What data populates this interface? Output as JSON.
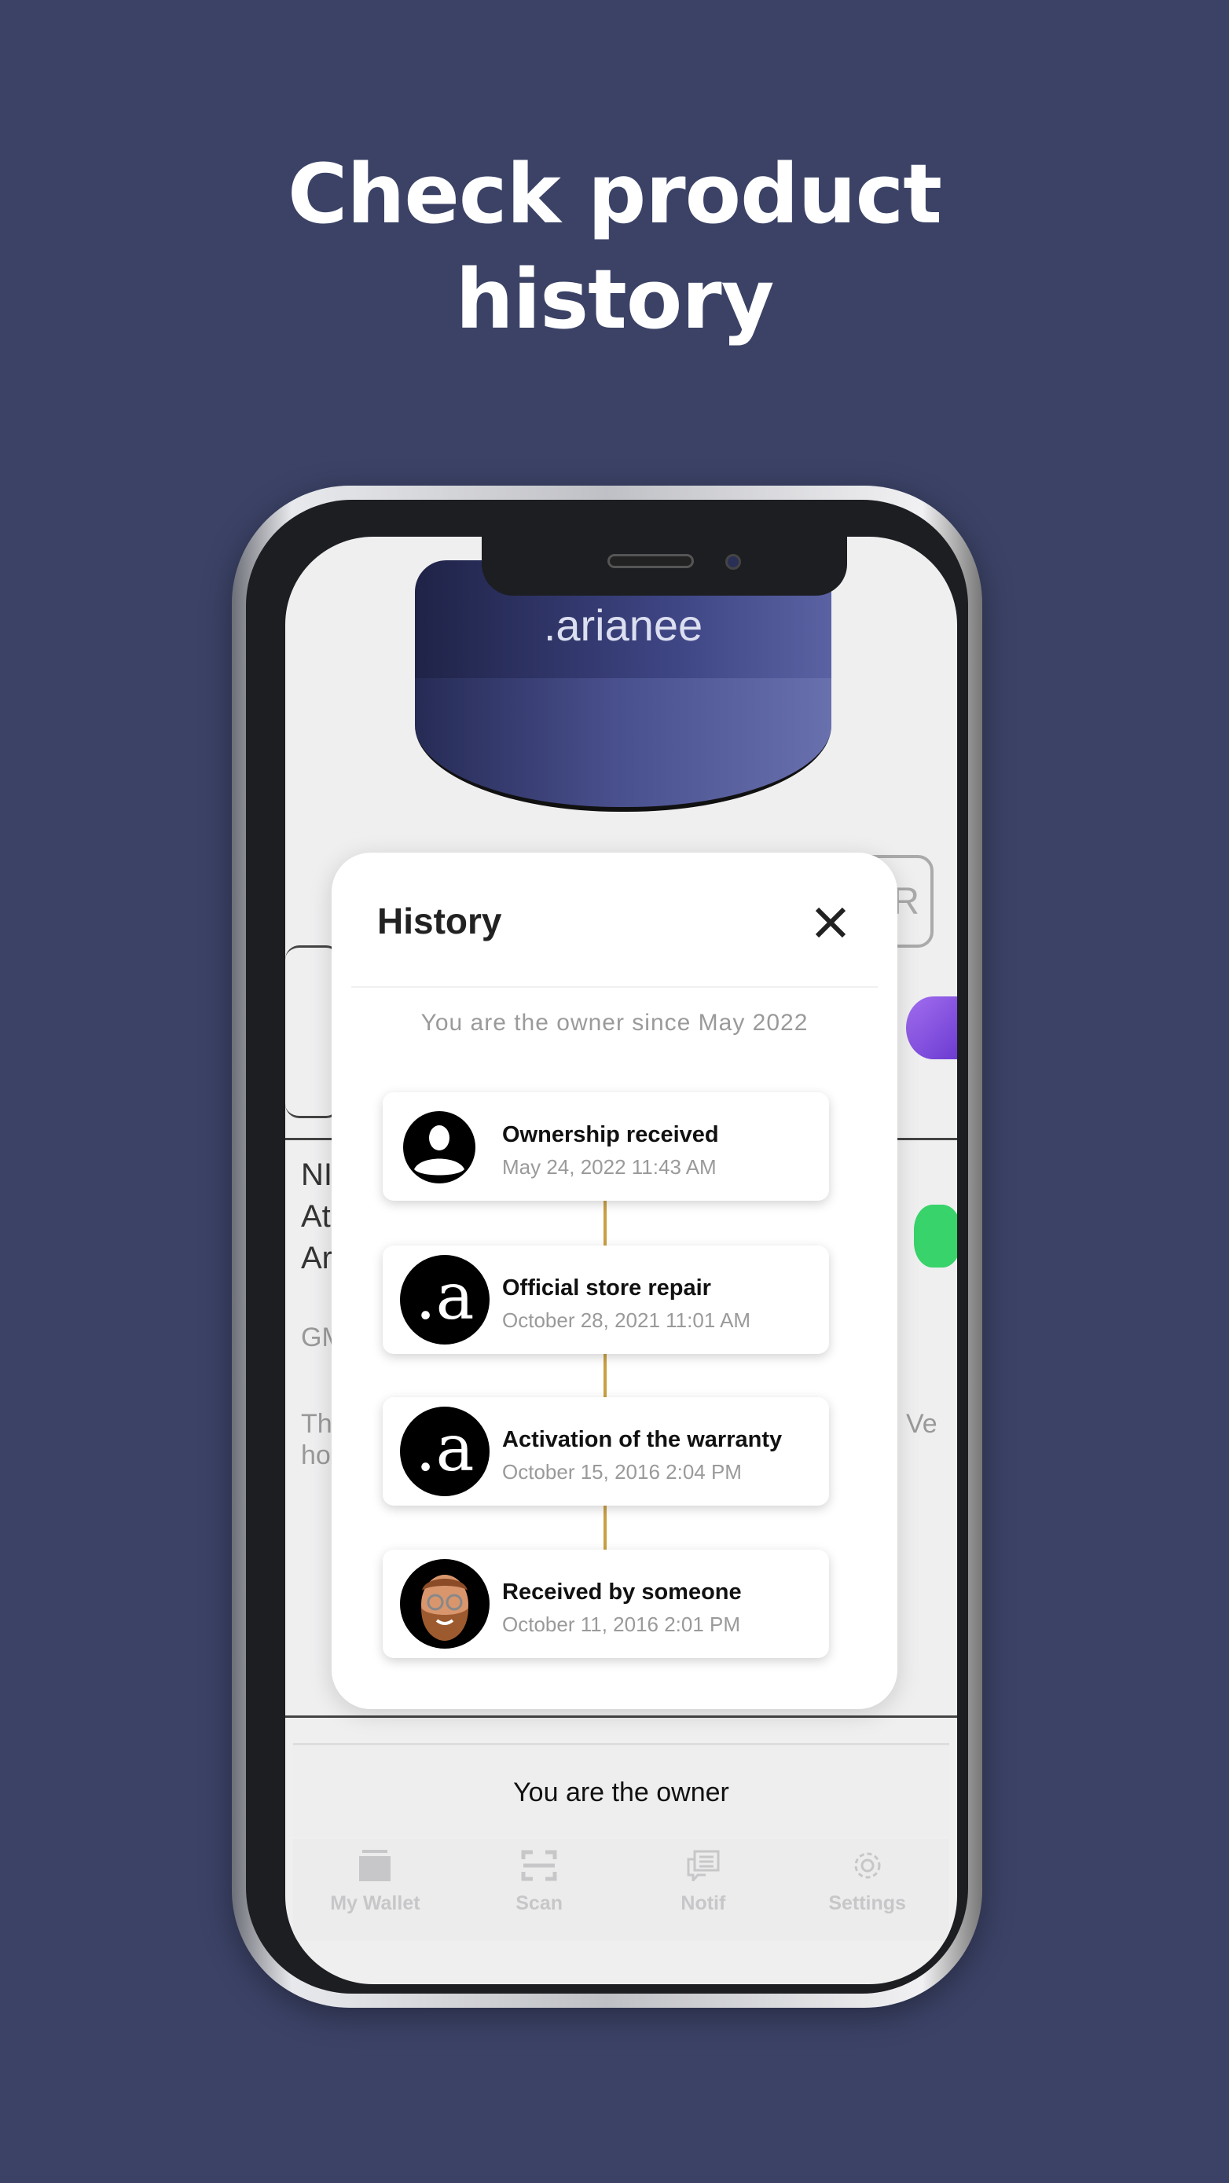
{
  "headline": {
    "line1": "Check product",
    "line2": "history"
  },
  "product": {
    "brand_logo": ".arianee"
  },
  "background_fragments": {
    "r_button": "R",
    "name1": "NI",
    "name2": "At",
    "name3": "Ar",
    "code": "GM",
    "desc1": "Th",
    "desc2": "ho",
    "right_fragment": "Ve"
  },
  "history_modal": {
    "title": "History",
    "close_icon": "close-icon",
    "owner_since": "You are the owner since May 2022",
    "timeline_color": "#c9a043",
    "events": [
      {
        "title": "Ownership received",
        "date": "May 24, 2022 11:43 AM",
        "icon": "user-icon"
      },
      {
        "title": "Official store repair",
        "date": "October 28, 2021 11:01 AM",
        "icon": "arianee-logo"
      },
      {
        "title": "Activation of the warranty",
        "date": "October 15, 2016 2:04 PM",
        "icon": "arianee-logo"
      },
      {
        "title": "Received by someone",
        "date": "October 11, 2016 2:01 PM",
        "icon": "memoji-avatar"
      }
    ]
  },
  "owner_bar": {
    "label": "You are the owner"
  },
  "bottom_nav": [
    {
      "label": "My Wallet",
      "icon": "wallet-icon"
    },
    {
      "label": "Scan",
      "icon": "scan-icon"
    },
    {
      "label": "Notif",
      "icon": "notification-icon"
    },
    {
      "label": "Settings",
      "icon": "gear-icon"
    }
  ],
  "colors": {
    "background": "#3b4266",
    "modal": "#ffffff",
    "timeline": "#c9a043"
  }
}
